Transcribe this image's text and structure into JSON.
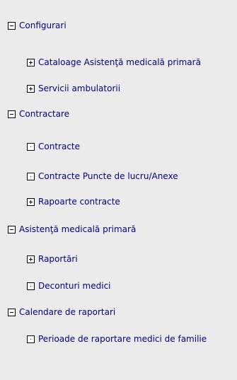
{
  "tree": {
    "items": [
      {
        "label": "Configurari",
        "icon": "collapse-icon"
      },
      {
        "label": "Cataloage Asistenţă medicală primară",
        "icon": "expand-icon"
      },
      {
        "label": "Servicii ambulatorii",
        "icon": "expand-icon"
      },
      {
        "label": "Contractare",
        "icon": "collapse-icon"
      },
      {
        "label": "Contracte",
        "icon": "leaf-icon"
      },
      {
        "label": "Contracte Puncte de lucru/Anexe",
        "icon": "leaf-icon"
      },
      {
        "label": "Rapoarte contracte",
        "icon": "expand-icon"
      },
      {
        "label": "Asistenţă medicală primară",
        "icon": "collapse-icon"
      },
      {
        "label": "Raportări",
        "icon": "expand-icon"
      },
      {
        "label": "Deconturi medici",
        "icon": "leaf-icon"
      },
      {
        "label": "Calendare de raportari",
        "icon": "collapse-icon"
      },
      {
        "label": "Perioade de raportare medici de familie",
        "icon": "leaf-icon"
      }
    ]
  },
  "colors": {
    "background": "#ebebeb",
    "link": "#000080"
  }
}
